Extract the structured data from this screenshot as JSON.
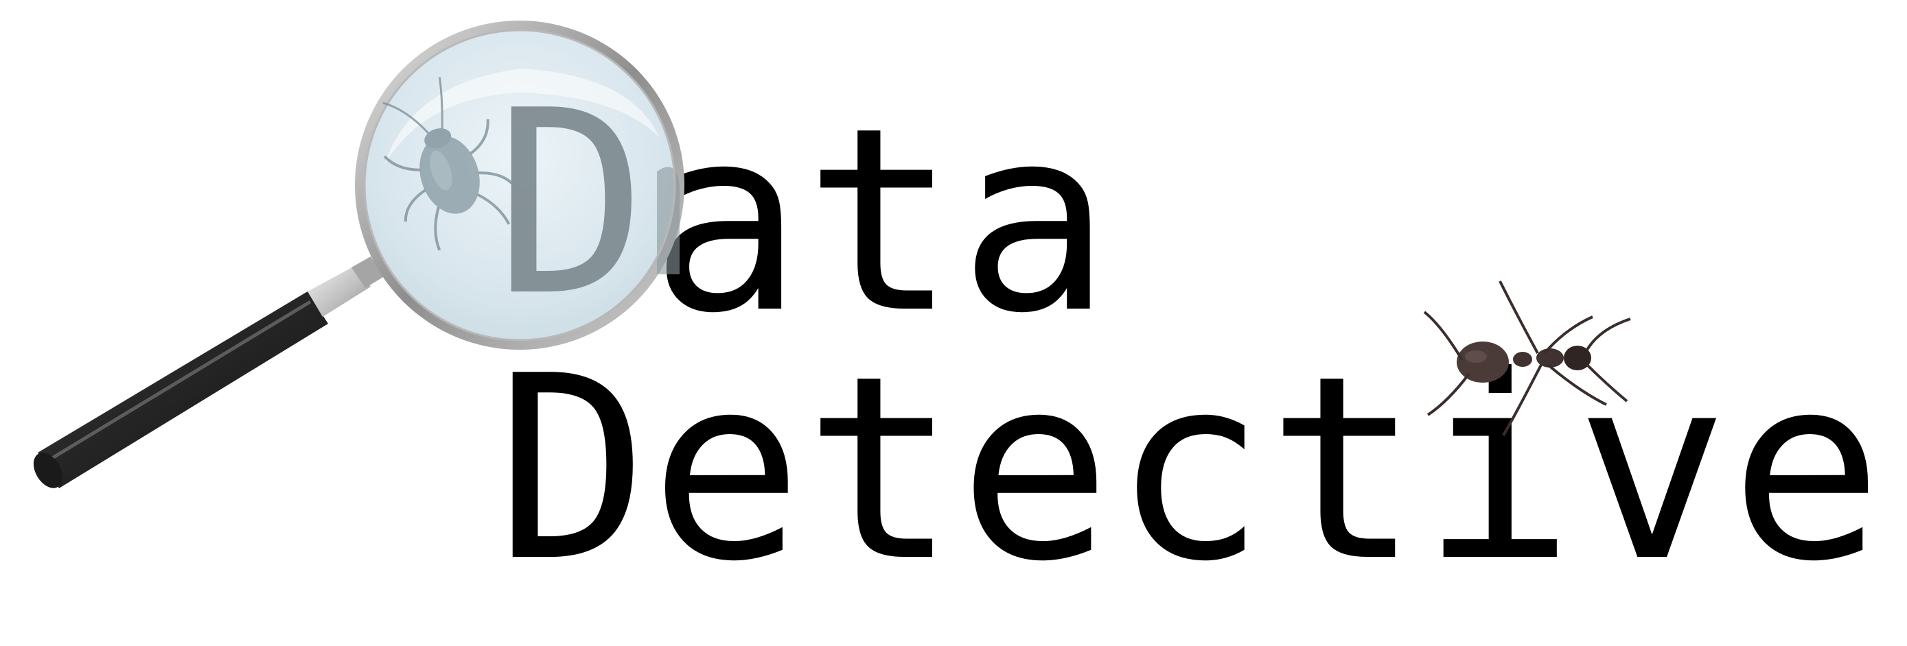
{
  "logo": {
    "line1": "Data",
    "line2": "Detective"
  },
  "colors": {
    "text": "#000000",
    "background": "#ffffff",
    "lens_tint": "#d6e6ee",
    "lens_rim": "#9a9a9a",
    "handle": "#2a2a2a",
    "beetle": "#8c9ea6",
    "ant": "#4a3a38"
  },
  "icons": {
    "magnifier": "magnifying-glass-icon",
    "beetle": "beetle-icon",
    "ant": "ant-icon"
  }
}
